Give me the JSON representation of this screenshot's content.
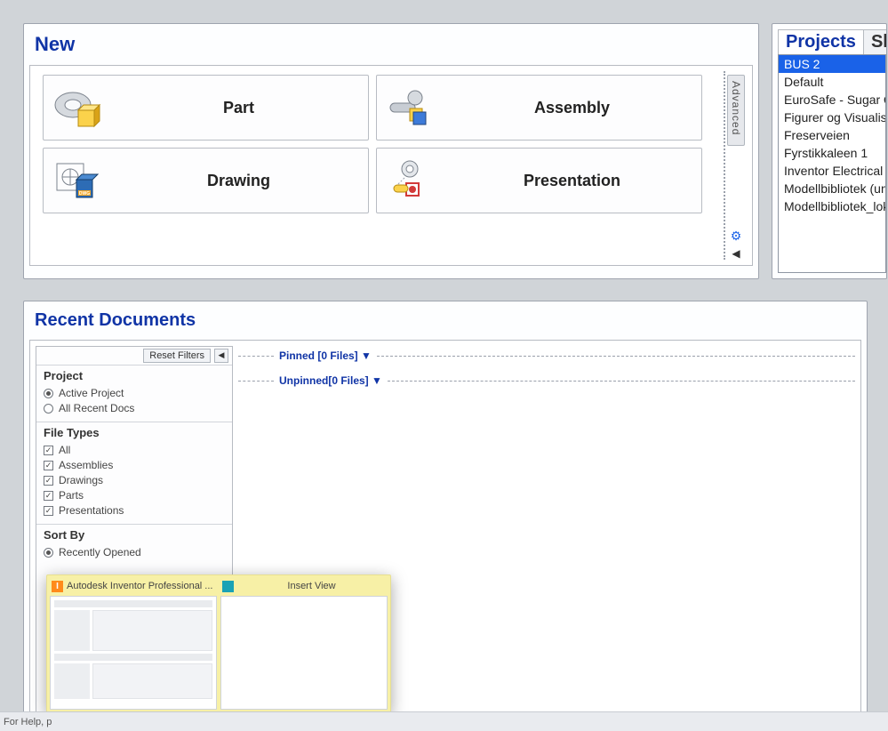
{
  "new_panel": {
    "title": "New",
    "advanced_label": "Advanced",
    "templates": [
      {
        "label": "Part"
      },
      {
        "label": "Assembly"
      },
      {
        "label": "Drawing"
      },
      {
        "label": "Presentation"
      }
    ]
  },
  "projects_panel": {
    "tabs": [
      {
        "label": "Projects",
        "active": true
      },
      {
        "label": "Sh",
        "active": false
      }
    ],
    "items": [
      "BUS 2",
      "Default",
      "EuroSafe - Sugar Q",
      "Figurer og Visualise",
      "Freserveien",
      "Fyrstikkaleen 1",
      "Inventor Electrical P",
      "Modellbibliotek (und",
      "Modellbibliotek_loka"
    ],
    "selected_index": 0
  },
  "recent_panel": {
    "title": "Recent Documents",
    "reset_label": "Reset Filters",
    "pinned_label": "Pinned [0 Files] ▼",
    "unpinned_label": "Unpinned[0 Files] ▼",
    "filters": {
      "project": {
        "title": "Project",
        "options": [
          {
            "label": "Active Project",
            "checked": true
          },
          {
            "label": "All Recent Docs",
            "checked": false
          }
        ]
      },
      "file_types": {
        "title": "File Types",
        "options": [
          {
            "label": "All",
            "checked": true
          },
          {
            "label": "Assemblies",
            "checked": true
          },
          {
            "label": "Drawings",
            "checked": true
          },
          {
            "label": "Parts",
            "checked": true
          },
          {
            "label": "Presentations",
            "checked": true
          }
        ]
      },
      "sort_by": {
        "title": "Sort By",
        "options": [
          {
            "label": "Recently Opened",
            "checked": true
          }
        ]
      }
    }
  },
  "taskbar_thumbs": [
    {
      "title": "Autodesk Inventor Professional ..."
    },
    {
      "title": "Insert View"
    }
  ],
  "status_bar": {
    "text": "For Help, p"
  }
}
